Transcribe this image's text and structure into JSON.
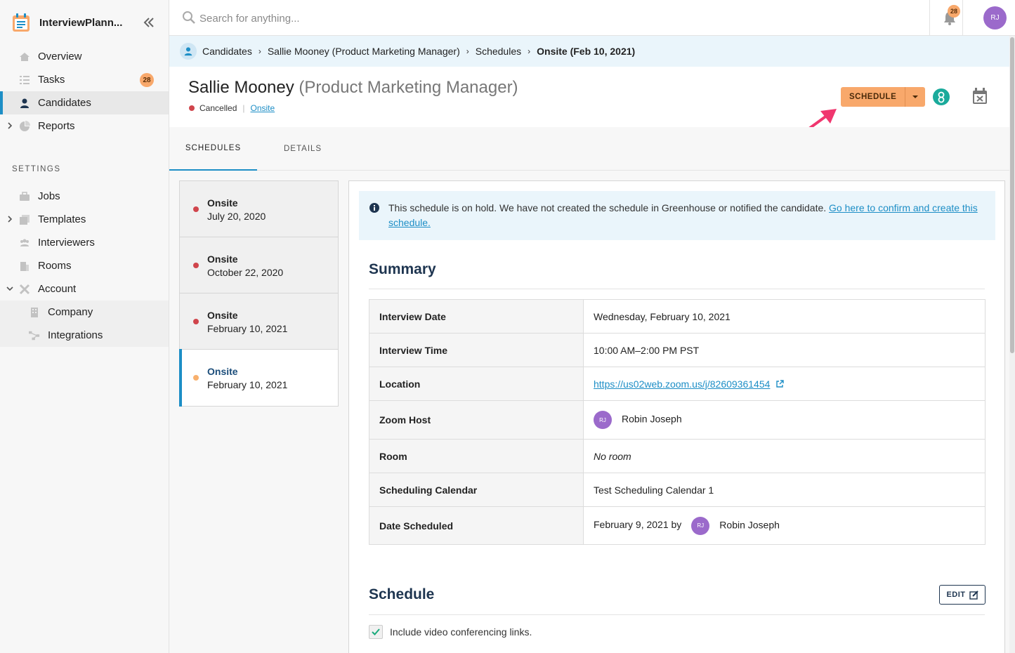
{
  "app": {
    "name": "InterviewPlann..."
  },
  "sidebar": {
    "items": [
      {
        "label": "Overview",
        "icon": "home-icon"
      },
      {
        "label": "Tasks",
        "icon": "tasks-icon",
        "badge": "28"
      },
      {
        "label": "Candidates",
        "icon": "candidate-icon",
        "active": true
      },
      {
        "label": "Reports",
        "icon": "reports-icon"
      }
    ],
    "settings_label": "SETTINGS",
    "settings_items": [
      {
        "label": "Jobs",
        "icon": "briefcase-icon"
      },
      {
        "label": "Templates",
        "icon": "templates-icon"
      },
      {
        "label": "Interviewers",
        "icon": "interviewers-icon"
      },
      {
        "label": "Rooms",
        "icon": "rooms-icon"
      },
      {
        "label": "Account",
        "icon": "account-icon"
      }
    ],
    "account_sub": [
      {
        "label": "Company",
        "icon": "building-icon"
      },
      {
        "label": "Integrations",
        "icon": "integrations-icon"
      }
    ]
  },
  "topbar": {
    "search_placeholder": "Search for anything...",
    "notifications_count": "28",
    "user_initials": "RJ"
  },
  "breadcrumb": [
    "Candidates",
    "Sallie Mooney (Product Marketing Manager)",
    "Schedules",
    "Onsite (Feb 10, 2021)"
  ],
  "header": {
    "candidate_name": "Sallie Mooney",
    "candidate_role": "(Product Marketing Manager)",
    "status": "Cancelled",
    "stage_link": "Onsite",
    "schedule_button": "SCHEDULE"
  },
  "tabs": [
    {
      "label": "SCHEDULES",
      "active": true
    },
    {
      "label": "DETAILS"
    }
  ],
  "schedules": [
    {
      "title": "Onsite",
      "date": "July 20, 2020",
      "status": "cancelled"
    },
    {
      "title": "Onsite",
      "date": "October 22, 2020",
      "status": "cancelled"
    },
    {
      "title": "Onsite",
      "date": "February 10, 2021",
      "status": "cancelled"
    },
    {
      "title": "Onsite",
      "date": "February 10, 2021",
      "status": "on-hold",
      "selected": true
    }
  ],
  "info": {
    "message": "This schedule is on hold. We have not created the schedule in Greenhouse or notified the candidate.",
    "link_text": "Go here to confirm and create this schedule."
  },
  "summary": {
    "title": "Summary",
    "rows": {
      "interview_date": {
        "label": "Interview Date",
        "value": "Wednesday, February 10, 2021"
      },
      "interview_time": {
        "label": "Interview Time",
        "value": "10:00 AM–2:00 PM PST"
      },
      "location": {
        "label": "Location",
        "value": "https://us02web.zoom.us/j/82609361454"
      },
      "zoom_host": {
        "label": "Zoom Host",
        "initials": "RJ",
        "value": "Robin Joseph"
      },
      "room": {
        "label": "Room",
        "value": "No room"
      },
      "scheduling_calendar": {
        "label": "Scheduling Calendar",
        "value": "Test Scheduling Calendar 1"
      },
      "date_scheduled": {
        "label": "Date Scheduled",
        "date": "February 9, 2021 by",
        "initials": "RJ",
        "value": "Robin Joseph"
      }
    }
  },
  "schedule_section": {
    "title": "Schedule",
    "edit_label": "EDIT",
    "video_checkbox_label": "Include video conferencing links.",
    "video_checked": true
  },
  "colors": {
    "accent": "#1d8ec6",
    "orange": "#f8a86b",
    "cancelled": "#d0454c",
    "on_hold": "#f8b06d",
    "heading": "#1e3550"
  }
}
